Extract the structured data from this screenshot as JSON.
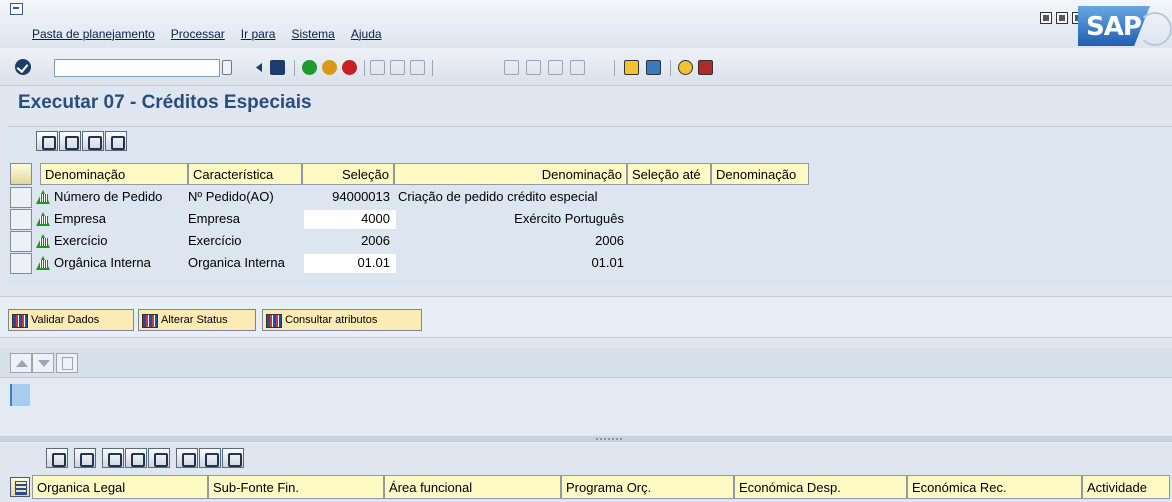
{
  "menubar": {
    "items": [
      "Pasta de planejamento",
      "Processar",
      "Ir para",
      "Sistema",
      "Ajuda"
    ]
  },
  "brand": {
    "logo_text": "SAP"
  },
  "toolbar": {
    "command_value": ""
  },
  "page": {
    "title": "Executar 07 - Créditos Especiais"
  },
  "grid1": {
    "headers": [
      "Denominação",
      "Característica",
      "Seleção",
      "Denominação",
      "Seleção até",
      "Denominação"
    ],
    "rows": [
      {
        "denominacao": "Número de Pedido",
        "caracteristica": "Nº Pedido(AO)",
        "selecao": "94000013",
        "denominacao2": "Criação de pedido crédito especial"
      },
      {
        "denominacao": "Empresa",
        "caracteristica": "Empresa",
        "selecao": "4000",
        "denominacao2": "Exército Português"
      },
      {
        "denominacao": "Exercício",
        "caracteristica": "Exercício",
        "selecao": "2006",
        "denominacao2": "2006"
      },
      {
        "denominacao": "Orgânica Interna",
        "caracteristica": "Organica Interna",
        "selecao": "01.01",
        "denominacao2": "01.01"
      }
    ]
  },
  "actions": {
    "validar": "Validar Dados",
    "alterar": "Alterar Status",
    "consultar": "Consultar atributos"
  },
  "grid2": {
    "headers": [
      "Organica Legal",
      "Sub-Fonte Fin.",
      "Área funcional",
      "Programa Orç.",
      "Económica Desp.",
      "Económica Rec.",
      "Actividade"
    ]
  },
  "colors": {
    "title": "#274e7c",
    "header_bg": "#fff9c4",
    "button_bg": "#fdebb5"
  }
}
